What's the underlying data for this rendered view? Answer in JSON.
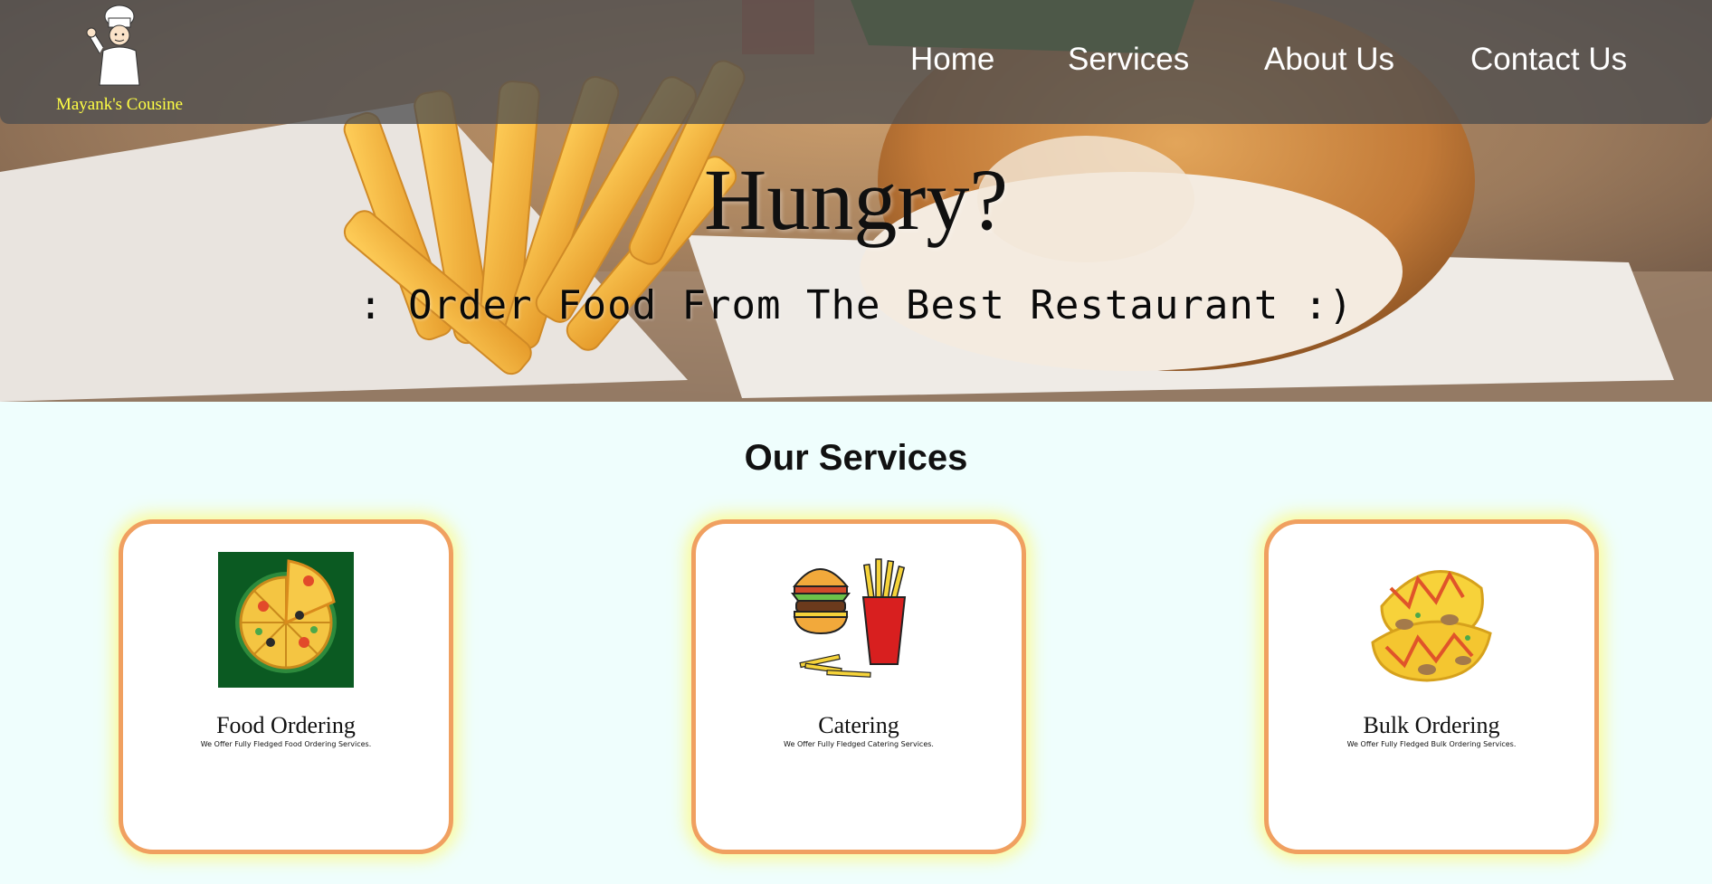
{
  "brand": {
    "name": "Mayank's Cousine",
    "logo_icon": "chef-icon",
    "text_color": "#ffff44"
  },
  "nav": {
    "links": [
      {
        "label": "Home"
      },
      {
        "label": "Services"
      },
      {
        "label": "About Us"
      },
      {
        "label": "Contact Us"
      }
    ]
  },
  "hero": {
    "title": "Hungry?",
    "subtitle": ": Order Food From The Best Restaurant :)"
  },
  "services": {
    "heading": "Our Services",
    "cards": [
      {
        "icon": "pizza-icon",
        "title": "Food Ordering",
        "description": "We Offer Fully Fledged Food Ordering Services."
      },
      {
        "icon": "burger-fries-icon",
        "title": "Catering",
        "description": "We Offer Fully Fledged Catering Services."
      },
      {
        "icon": "omelette-icon",
        "title": "Bulk Ordering",
        "description": "We Offer Fully Fledged Bulk Ordering Services."
      }
    ]
  },
  "colors": {
    "page_background": "#effefd",
    "card_border": "#f0a060",
    "card_glow": "#fffa78",
    "navbar": "#4e4e50"
  }
}
